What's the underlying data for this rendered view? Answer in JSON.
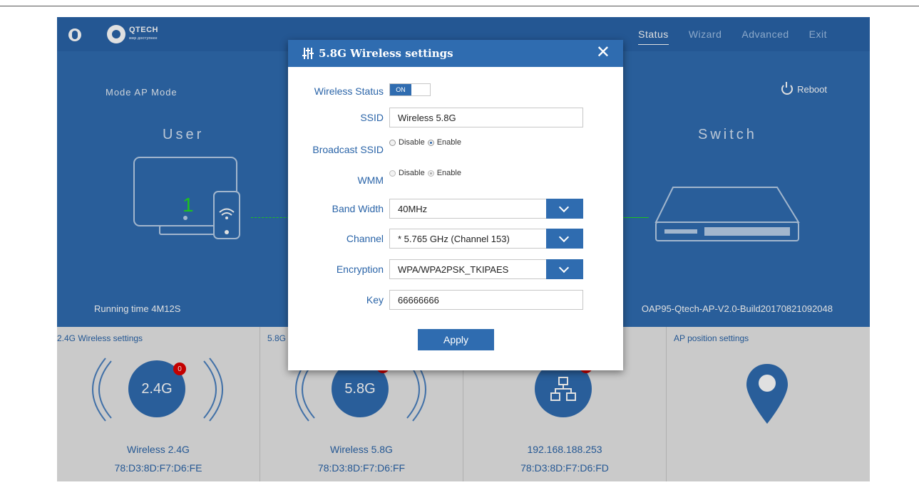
{
  "nav": {
    "items": [
      "Status",
      "Wizard",
      "Advanced",
      "Exit"
    ],
    "active": "Status"
  },
  "logo": {
    "text": "QTECH",
    "subtext": "мир доступнее"
  },
  "status": {
    "mode": "Mode  AP Mode",
    "reboot": "Reboot",
    "user_label": "User",
    "switch_label": "Switch",
    "user_count": "1",
    "running_time": "Running time  4M12S",
    "firmware": "OAP95-Qtech-AP-V2.0-Build20170821092048"
  },
  "cards": [
    {
      "title": "2.4G Wireless settings",
      "circle": "2.4G",
      "badge": "0",
      "line1": "Wireless 2.4G",
      "line2": "78:D3:8D:F7:D6:FE"
    },
    {
      "title": "5.8G",
      "circle": "5.8G",
      "line1": "Wireless 5.8G",
      "line2": "78:D3:8D:F7:D6:FF"
    },
    {
      "title": "",
      "line1": "192.168.188.253",
      "line2": "78:D3:8D:F7:D6:FD"
    },
    {
      "title": "AP position settings"
    }
  ],
  "modal": {
    "title": "5.8G Wireless settings",
    "wireless_status_label": "Wireless Status",
    "wireless_status_value": "ON",
    "ssid_label": "SSID",
    "ssid_value": "Wireless 5.8G",
    "broadcast_label": "Broadcast SSID",
    "wmm_label": "WMM",
    "disable": "Disable",
    "enable": "Enable",
    "bandwidth_label": "Band Width",
    "bandwidth_value": "40MHz",
    "channel_label": "Channel",
    "channel_value": "* 5.765 GHz (Channel 153)",
    "encryption_label": "Encryption",
    "encryption_value": "WPA/WPA2PSK_TKIPAES",
    "key_label": "Key",
    "key_value": "66666666",
    "apply": "Apply"
  },
  "colors": {
    "primary": "#2f6cb0",
    "header": "#2a64a8",
    "badge": "#e00000",
    "user_count": "#22dd22"
  }
}
